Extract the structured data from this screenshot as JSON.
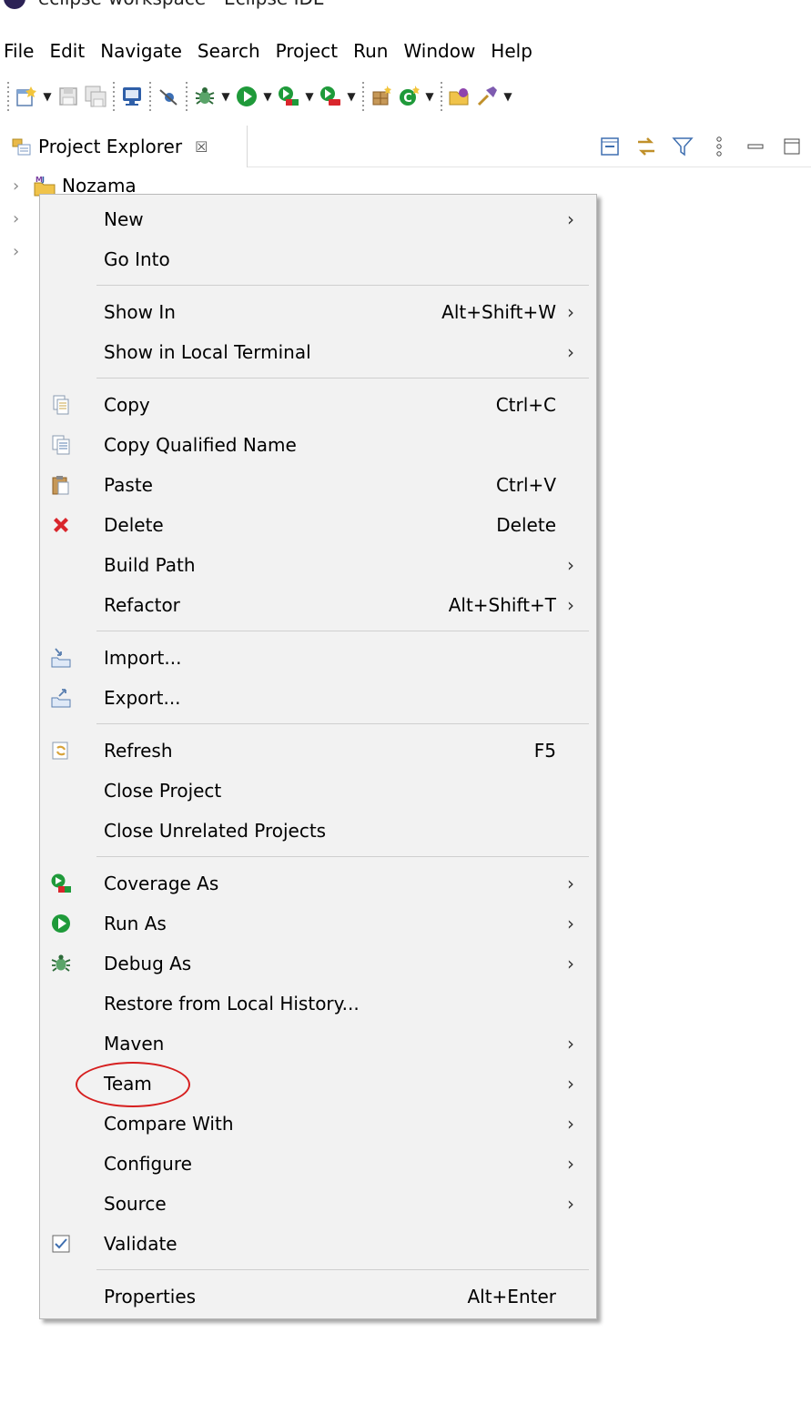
{
  "window": {
    "title": "eclipse-workspace - Eclipse IDE"
  },
  "menubar": [
    "File",
    "Edit",
    "Navigate",
    "Search",
    "Project",
    "Run",
    "Window",
    "Help"
  ],
  "toolbar": {
    "icons": [
      "new-wizard-icon",
      "save-icon",
      "save-all-icon",
      "console-icon",
      "skip-breakpoints-icon",
      "debug-icon",
      "run-icon",
      "coverage-icon",
      "external-tools-icon",
      "new-java-package-icon",
      "new-class-icon",
      "open-type-icon",
      "search-icon"
    ]
  },
  "panel": {
    "tab_label": "Project Explorer",
    "tab_close": "☒"
  },
  "tree": {
    "items": [
      {
        "label": "Nozama",
        "expanded": false
      },
      {
        "label": ""
      },
      {
        "label": ""
      }
    ]
  },
  "context_menu": {
    "items": [
      {
        "id": "new",
        "label": "New",
        "shortcut": "",
        "submenu": true,
        "icon": ""
      },
      {
        "id": "go-into",
        "label": "Go Into",
        "shortcut": "",
        "submenu": false,
        "icon": ""
      },
      {
        "sep": true
      },
      {
        "id": "show-in",
        "label": "Show In",
        "shortcut": "Alt+Shift+W",
        "submenu": true,
        "icon": ""
      },
      {
        "id": "show-in-local-terminal",
        "label": "Show in Local Terminal",
        "shortcut": "",
        "submenu": true,
        "icon": ""
      },
      {
        "sep": true
      },
      {
        "id": "copy",
        "label": "Copy",
        "shortcut": "Ctrl+C",
        "submenu": false,
        "icon": "copy-icon"
      },
      {
        "id": "copy-qualified-name",
        "label": "Copy Qualified Name",
        "shortcut": "",
        "submenu": false,
        "icon": "copy-qualified-name-icon"
      },
      {
        "id": "paste",
        "label": "Paste",
        "shortcut": "Ctrl+V",
        "submenu": false,
        "icon": "paste-icon"
      },
      {
        "id": "delete",
        "label": "Delete",
        "shortcut": "Delete",
        "submenu": false,
        "icon": "delete-icon"
      },
      {
        "id": "build-path",
        "label": "Build Path",
        "shortcut": "",
        "submenu": true,
        "icon": ""
      },
      {
        "id": "refactor",
        "label": "Refactor",
        "shortcut": "Alt+Shift+T",
        "submenu": true,
        "icon": ""
      },
      {
        "sep": true
      },
      {
        "id": "import",
        "label": "Import...",
        "shortcut": "",
        "submenu": false,
        "icon": "import-icon"
      },
      {
        "id": "export",
        "label": "Export...",
        "shortcut": "",
        "submenu": false,
        "icon": "export-icon"
      },
      {
        "sep": true
      },
      {
        "id": "refresh",
        "label": "Refresh",
        "shortcut": "F5",
        "submenu": false,
        "icon": "refresh-icon"
      },
      {
        "id": "close-project",
        "label": "Close Project",
        "shortcut": "",
        "submenu": false,
        "icon": ""
      },
      {
        "id": "close-unrelated-projects",
        "label": "Close Unrelated Projects",
        "shortcut": "",
        "submenu": false,
        "icon": ""
      },
      {
        "sep": true
      },
      {
        "id": "coverage-as",
        "label": "Coverage As",
        "shortcut": "",
        "submenu": true,
        "icon": "coverage-icon"
      },
      {
        "id": "run-as",
        "label": "Run As",
        "shortcut": "",
        "submenu": true,
        "icon": "run-icon"
      },
      {
        "id": "debug-as",
        "label": "Debug As",
        "shortcut": "",
        "submenu": true,
        "icon": "debug-icon"
      },
      {
        "id": "restore-from-local-history",
        "label": "Restore from Local History...",
        "shortcut": "",
        "submenu": false,
        "icon": ""
      },
      {
        "id": "maven",
        "label": "Maven",
        "shortcut": "",
        "submenu": true,
        "icon": ""
      },
      {
        "id": "team",
        "label": "Team",
        "shortcut": "",
        "submenu": true,
        "icon": "",
        "highlighted": true
      },
      {
        "id": "compare-with",
        "label": "Compare With",
        "shortcut": "",
        "submenu": true,
        "icon": ""
      },
      {
        "id": "configure",
        "label": "Configure",
        "shortcut": "",
        "submenu": true,
        "icon": ""
      },
      {
        "id": "source",
        "label": "Source",
        "shortcut": "",
        "submenu": true,
        "icon": ""
      },
      {
        "id": "validate",
        "label": "Validate",
        "shortcut": "",
        "submenu": false,
        "icon": "checkbox-checked-icon"
      },
      {
        "sep": true
      },
      {
        "id": "properties",
        "label": "Properties",
        "shortcut": "Alt+Enter",
        "submenu": false,
        "icon": ""
      }
    ]
  },
  "colors": {
    "menu_bg": "#f2f2f2",
    "annotation": "#d61f1f",
    "run_green": "#1f9a3a",
    "delete_red": "#d9262c"
  }
}
